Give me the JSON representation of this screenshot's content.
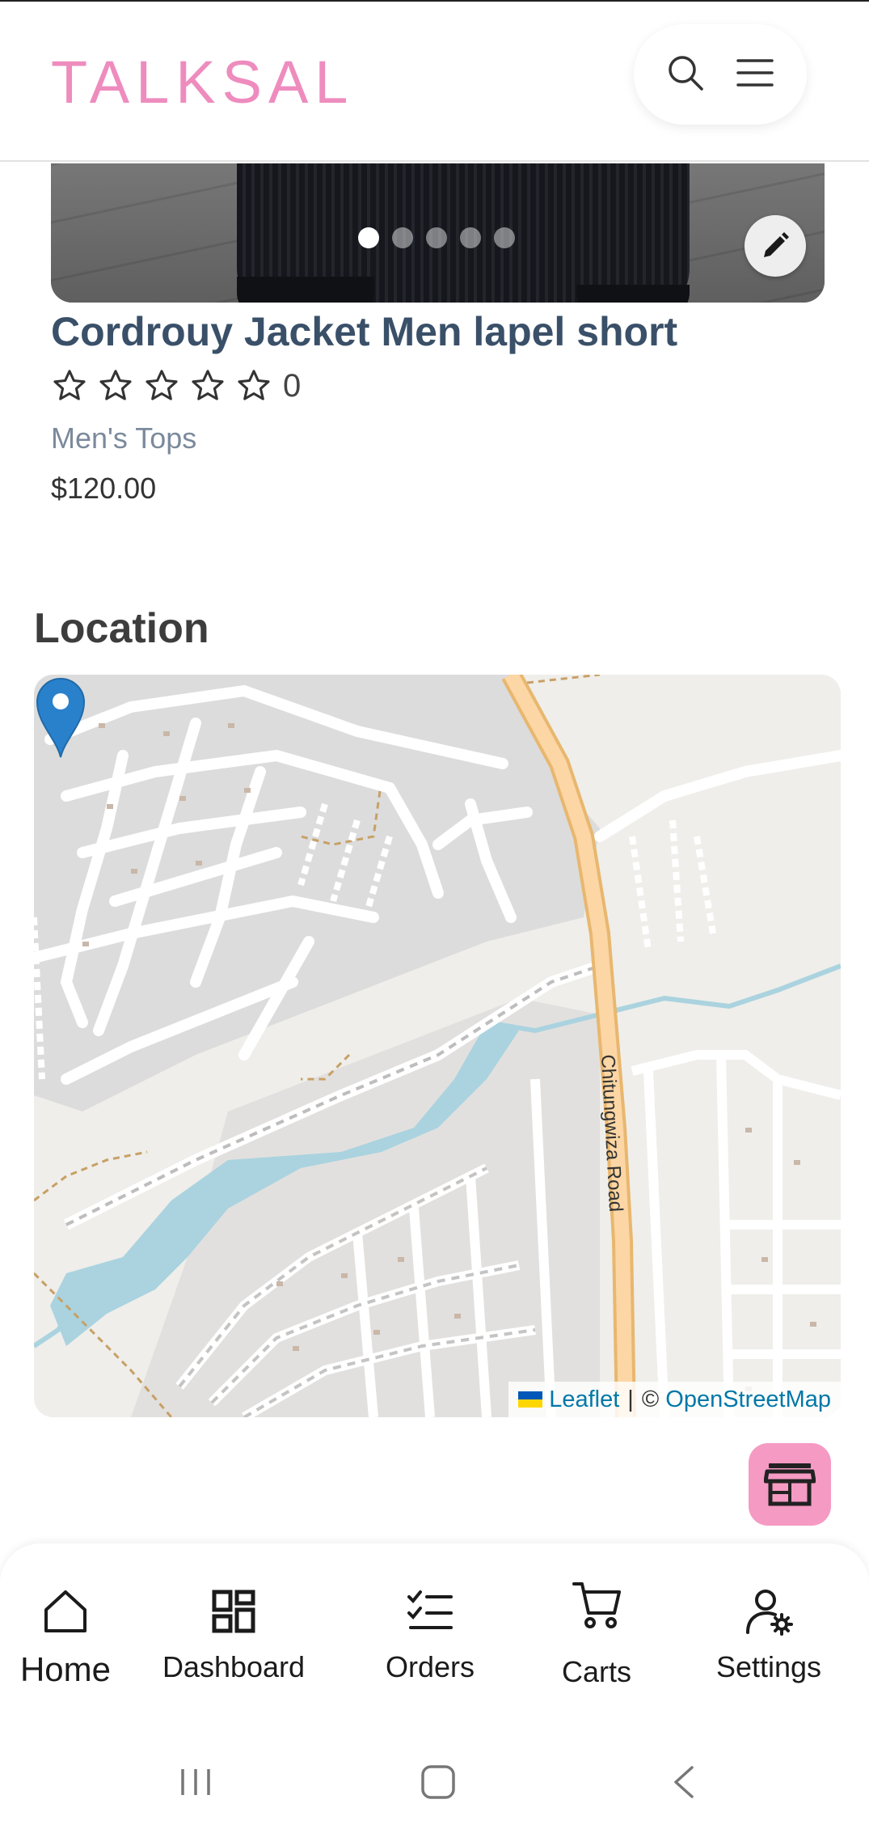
{
  "app": {
    "logo": "TALKSAL"
  },
  "header": {
    "search_icon": "search-icon",
    "menu_icon": "hamburger-menu-icon"
  },
  "product": {
    "image_count": 5,
    "active_image": 1,
    "title": "Cordrouy Jacket Men lapel short",
    "rating_stars": 5,
    "rating_value": 0,
    "rating_count": "0",
    "category": "Men's Tops",
    "price": "$120.00"
  },
  "location": {
    "heading": "Location",
    "road_label": "Chitungwiza Road",
    "attribution": {
      "leaflet": "Leaflet",
      "separator": "|",
      "copyright": "©",
      "osm": "OpenStreetMap"
    }
  },
  "bottom_nav": {
    "items": [
      {
        "label": "Home",
        "icon": "home-icon",
        "active": true
      },
      {
        "label": "Dashboard",
        "icon": "dashboard-icon",
        "active": false
      },
      {
        "label": "Orders",
        "icon": "orders-checklist-icon",
        "active": false
      },
      {
        "label": "Carts",
        "icon": "cart-icon",
        "active": false
      },
      {
        "label": "Settings",
        "icon": "user-settings-icon",
        "active": false
      }
    ]
  },
  "colors": {
    "brand_pink": "#ee8cbe",
    "title_blue": "#3a5069",
    "fab_pink": "#f59ac3",
    "link_blue": "#0078a8"
  }
}
